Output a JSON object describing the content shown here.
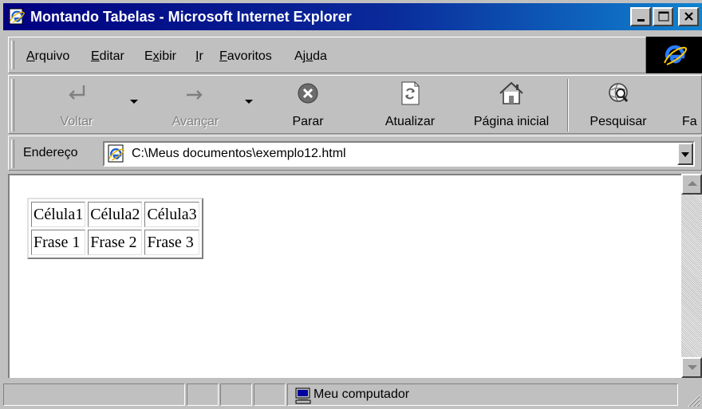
{
  "window": {
    "title": "Montando Tabelas - Microsoft Internet Explorer"
  },
  "menu": {
    "items": [
      "Arquivo",
      "Editar",
      "Exibir",
      "Ir",
      "Favoritos",
      "Ajuda"
    ]
  },
  "toolbar": {
    "back": "Voltar",
    "forward": "Avançar",
    "stop": "Parar",
    "refresh": "Atualizar",
    "home": "Página inicial",
    "search": "Pesquisar",
    "favorites_partial": "Fa"
  },
  "address": {
    "label": "Endereço",
    "url": "C:\\Meus documentos\\exemplo12.html"
  },
  "page": {
    "table": {
      "rows": [
        [
          "Célula1",
          "Célula2",
          "Célula3"
        ],
        [
          "Frase 1",
          "Frase 2",
          "Frase 3"
        ]
      ]
    }
  },
  "status": {
    "zone": "Meu computador"
  },
  "icons": {
    "title": "ie-page-icon",
    "logo": "ie-logo-icon",
    "back": "back-arrow-icon",
    "forward": "forward-arrow-icon",
    "stop": "stop-icon",
    "refresh": "refresh-icon",
    "home": "home-icon",
    "search": "search-globe-icon",
    "zone": "computer-icon"
  },
  "colors": {
    "titlebar_start": "#000080",
    "titlebar_end": "#1084d0",
    "chrome": "#c0c0c0",
    "logo_bg": "#000000"
  }
}
